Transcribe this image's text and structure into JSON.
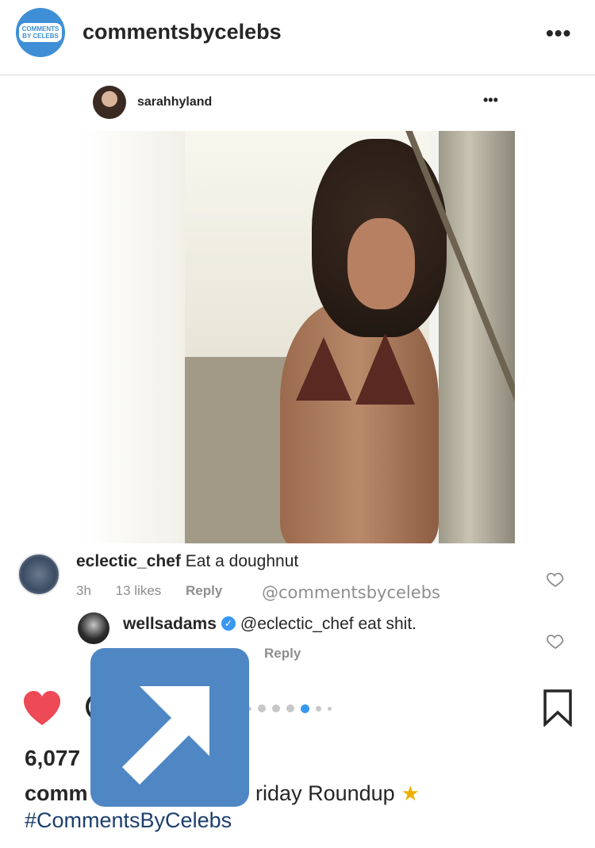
{
  "header": {
    "avatar_text_top": "COMMENTS",
    "avatar_text_bottom": "BY CELEBS",
    "username": "commentsbycelebs",
    "more_label": "•••"
  },
  "embedded_post": {
    "username": "sarahhyland",
    "more_label": "•••"
  },
  "comments": [
    {
      "username": "eclectic_chef",
      "text": "Eat a doughnut",
      "time": "3h",
      "likes": "13 likes",
      "reply_label": "Reply",
      "watermark": "@commentsbycelebs"
    },
    {
      "username": "wellsadams",
      "verified": true,
      "text": "@eclectic_chef eat shit.",
      "reply_label": "Reply"
    }
  ],
  "actions": {
    "liked": true,
    "carousel_dots": 7,
    "carousel_active_index": 4,
    "colors": {
      "like_red": "#ed4956",
      "overlay_blue": "#4f87c5",
      "active_dot": "#3897f0",
      "hashtag": "#1c3f6e"
    }
  },
  "likes_count": "6,077",
  "caption": {
    "username": "comm",
    "text": "riday Roundup",
    "emoji_icon": "dizzy-star-icon",
    "hashtag": "#CommentsByCelebs"
  }
}
